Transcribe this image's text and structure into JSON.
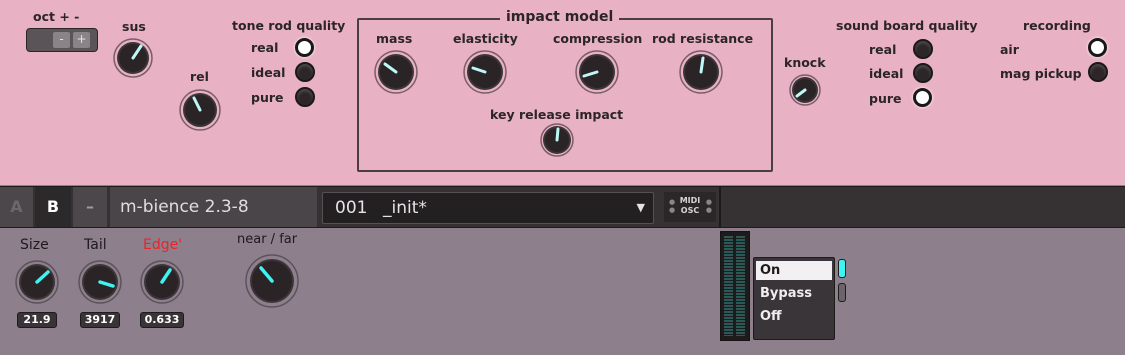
{
  "synth": {
    "octave": {
      "label": "oct + -",
      "minus": "-",
      "plus": "+"
    },
    "sus": "sus",
    "rel": "rel",
    "tone_rod_quality": {
      "title": "tone rod quality",
      "options": [
        "real",
        "ideal",
        "pure"
      ],
      "selected": "real"
    },
    "impact_model": {
      "title": "impact model",
      "knobs": [
        "mass",
        "elasticity",
        "compression",
        "rod resistance"
      ],
      "key_release_impact": "key release impact"
    },
    "knock": "knock",
    "sound_board_quality": {
      "title": "sound board quality",
      "options": [
        "real",
        "ideal",
        "pure"
      ],
      "selected": "pure"
    },
    "recording": {
      "title": "recording",
      "options": [
        "air",
        "mag pickup"
      ],
      "selected": "air"
    }
  },
  "strip": {
    "tab_a": "A",
    "tab_b": "B",
    "tab_dash": "–",
    "device_name": "m-bience 2.3-8",
    "preset_number": "001",
    "preset_name": "_init*",
    "midi_label": "MIDI",
    "osc_label": "OSC"
  },
  "effect": {
    "size": {
      "label": "Size",
      "value": "21.9"
    },
    "tail": {
      "label": "Tail",
      "value": "3917"
    },
    "edge": {
      "label": "Edge'",
      "value": "0.633"
    },
    "near_far": "near / far",
    "state_options": [
      "On",
      "Bypass",
      "Off"
    ],
    "state_selected": "On"
  },
  "colors": {
    "panel_pink": "#e8b1c4",
    "lower_mauve": "#8d7f8c",
    "accent_cyan": "#3ff4f0",
    "edge_red": "#e5262b"
  }
}
